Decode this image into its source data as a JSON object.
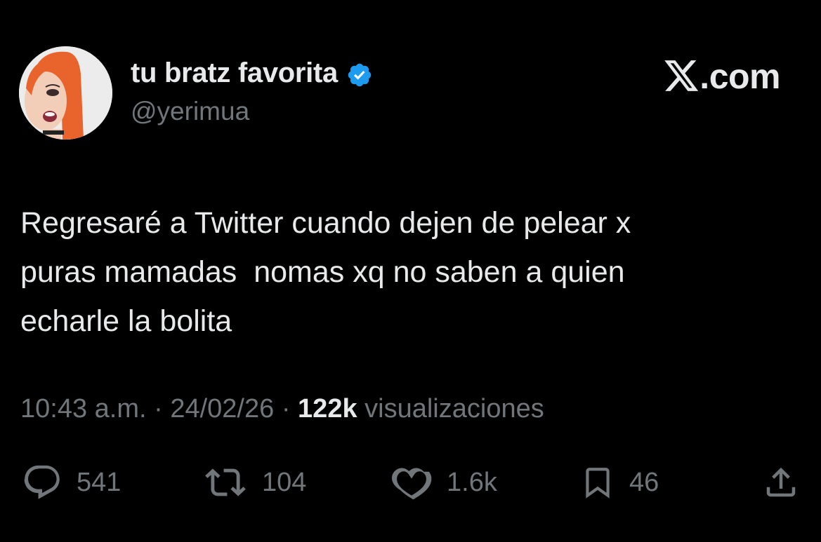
{
  "user": {
    "display_name": "tu bratz favorita",
    "handle": "@yerimua",
    "verified": true
  },
  "brand": {
    "text": ".com",
    "icon": "x-logo-icon"
  },
  "tweet": {
    "text": "Regresaré a Twitter cuando dejen de pelear x\npuras mamadas  nomas xq no saben a quien\necharle la bolita"
  },
  "meta": {
    "time": "10:43 a.m.",
    "separator": "·",
    "date": "24/02/26",
    "views_count": "122k",
    "views_label": "visualizaciones"
  },
  "actions": {
    "reply": {
      "icon": "reply-icon",
      "count": "541"
    },
    "retweet": {
      "icon": "retweet-icon",
      "count": "104"
    },
    "like": {
      "icon": "heart-icon",
      "count": "1.6k"
    },
    "bookmark": {
      "icon": "bookmark-icon",
      "count": "46"
    },
    "share": {
      "icon": "share-icon"
    }
  },
  "colors": {
    "background": "#000000",
    "text_primary": "#e7e9ea",
    "text_secondary": "#71767b",
    "verified_blue": "#1d9bf0",
    "avatar_hair": "#e8642c"
  }
}
